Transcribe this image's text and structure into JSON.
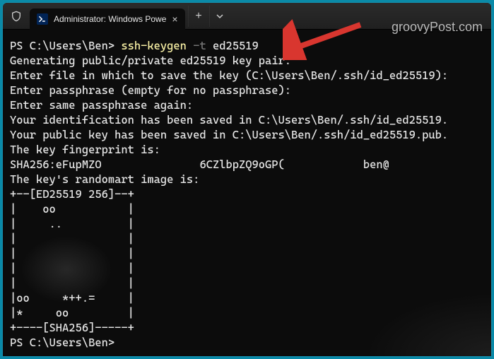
{
  "tab": {
    "title": "Administrator: Windows Powe"
  },
  "watermark": "groovyPost.com",
  "prompt": "PS C:\\Users\\Ben>",
  "cmd": {
    "exe": "ssh-keygen",
    "flag": "-t",
    "arg": "ed25519"
  },
  "lines": {
    "l1": "Generating public/private ed25519 key pair.",
    "l2": "Enter file in which to save the key (C:\\Users\\Ben/.ssh/id_ed25519):",
    "l3": "Enter passphrase (empty for no passphrase):",
    "l4": "Enter same passphrase again:",
    "l5": "Your identification has been saved in C:\\Users\\Ben/.ssh/id_ed25519.",
    "l6": "Your public key has been saved in C:\\Users\\Ben/.ssh/id_ed25519.pub.",
    "l7": "The key fingerprint is:",
    "fp1": "SHA256:eFupMZO",
    "fp2": "6CZlbpZQ9oGP(",
    "fp3": "ben@",
    "l8": "The key's randomart image is:",
    "r0": "+--[ED25519 256]--+",
    "r1": "|    oo           |",
    "r2": "|     ..          |",
    "r3": "|                 |",
    "r4": "|                 |",
    "r5": "|                 |",
    "r6": "|                 |",
    "r7": "|oo     *++.=     |",
    "r8": "|*     oo         |",
    "r9": "+----[SHA256]-----+"
  }
}
